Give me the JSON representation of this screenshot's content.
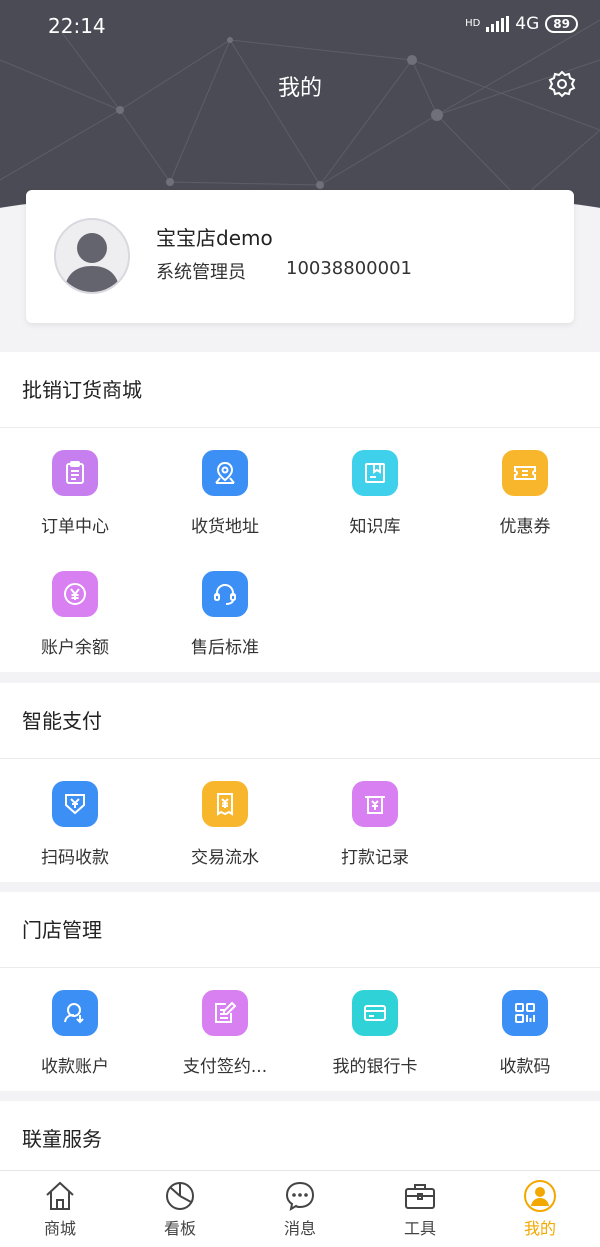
{
  "status": {
    "time": "22:14",
    "network": "4G",
    "hd": "HD",
    "battery": "89"
  },
  "header": {
    "title": "我的"
  },
  "profile": {
    "store_name": "宝宝店demo",
    "role": "系统管理员",
    "phone": "10038800001"
  },
  "sections": [
    {
      "title": "批销订货商城",
      "items": [
        {
          "label": "订单中心",
          "icon": "clipboard-icon",
          "color": "#c77ff0"
        },
        {
          "label": "收货地址",
          "icon": "map-location-icon",
          "color": "#3b8ff5"
        },
        {
          "label": "知识库",
          "icon": "book-icon",
          "color": "#3fd0ec"
        },
        {
          "label": "优惠券",
          "icon": "ticket-icon",
          "color": "#f8b62d"
        },
        {
          "label": "账户余额",
          "icon": "yuan-coin-icon",
          "color": "#d87ff2"
        },
        {
          "label": "售后标准",
          "icon": "headset-icon",
          "color": "#3b8ff5"
        }
      ]
    },
    {
      "title": "智能支付",
      "items": [
        {
          "label": "扫码收款",
          "icon": "scan-yuan-icon",
          "color": "#3b8ff5"
        },
        {
          "label": "交易流水",
          "icon": "receipt-icon",
          "color": "#f8b62d"
        },
        {
          "label": "打款记录",
          "icon": "atm-icon",
          "color": "#d87ff2"
        }
      ]
    },
    {
      "title": "门店管理",
      "items": [
        {
          "label": "收款账户",
          "icon": "account-icon",
          "color": "#3b8ff5"
        },
        {
          "label": "支付签约...",
          "icon": "edit-doc-icon",
          "color": "#d87ff2"
        },
        {
          "label": "我的银行卡",
          "icon": "bank-card-icon",
          "color": "#2fd3d7"
        },
        {
          "label": "收款码",
          "icon": "qr-code-icon",
          "color": "#3b8ff5"
        }
      ]
    },
    {
      "title": "联童服务",
      "items": []
    }
  ],
  "tabbar": [
    {
      "label": "商城",
      "icon": "home-icon",
      "active": false
    },
    {
      "label": "看板",
      "icon": "pie-chart-icon",
      "active": false
    },
    {
      "label": "消息",
      "icon": "message-icon",
      "active": false
    },
    {
      "label": "工具",
      "icon": "toolbox-icon",
      "active": false
    },
    {
      "label": "我的",
      "icon": "user-icon",
      "active": true
    }
  ],
  "colors": {
    "accent": "#f3a800",
    "header_bg": "#4b4b55"
  }
}
